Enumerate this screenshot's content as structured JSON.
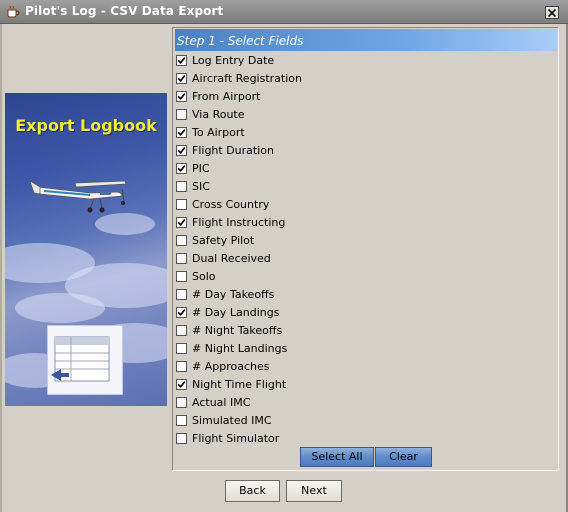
{
  "window": {
    "title": "Pilot's Log - CSV Data Export"
  },
  "banner": {
    "title": "Export Logbook"
  },
  "step": {
    "header": "Step 1 - Select Fields"
  },
  "fields": [
    {
      "label": "Log Entry Date",
      "checked": true
    },
    {
      "label": "Aircraft Registration",
      "checked": true
    },
    {
      "label": "From Airport",
      "checked": true
    },
    {
      "label": "Via Route",
      "checked": false
    },
    {
      "label": "To Airport",
      "checked": true
    },
    {
      "label": "Flight Duration",
      "checked": true
    },
    {
      "label": "PIC",
      "checked": true
    },
    {
      "label": "SIC",
      "checked": false
    },
    {
      "label": "Cross Country",
      "checked": false
    },
    {
      "label": "Flight Instructing",
      "checked": true
    },
    {
      "label": "Safety Pilot",
      "checked": false
    },
    {
      "label": "Dual Received",
      "checked": false
    },
    {
      "label": "Solo",
      "checked": false
    },
    {
      "label": "# Day Takeoffs",
      "checked": false
    },
    {
      "label": "# Day Landings",
      "checked": true
    },
    {
      "label": "# Night Takeoffs",
      "checked": false
    },
    {
      "label": "# Night Landings",
      "checked": false
    },
    {
      "label": "# Approaches",
      "checked": false
    },
    {
      "label": "Night Time Flight",
      "checked": true
    },
    {
      "label": "Actual IMC",
      "checked": false
    },
    {
      "label": "Simulated IMC",
      "checked": false
    },
    {
      "label": "Flight Simulator",
      "checked": false
    }
  ],
  "actions": {
    "select_all": "Select All",
    "clear": "Clear"
  },
  "nav": {
    "back": "Back",
    "next": "Next"
  },
  "icons": {
    "app": "coffee-cup-icon",
    "close": "close-icon",
    "check": "checkmark-icon"
  },
  "colors": {
    "banner_text": "#f2ee2c",
    "header_blue": "#4a82c4"
  }
}
